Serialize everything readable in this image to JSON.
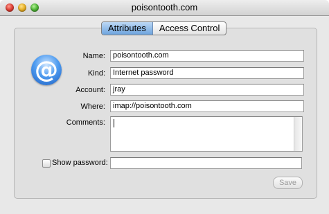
{
  "window": {
    "title": "poisontooth.com"
  },
  "tabs": [
    {
      "label": "Attributes",
      "active": true
    },
    {
      "label": "Access Control",
      "active": false
    }
  ],
  "icon": {
    "name": "at-sign-icon",
    "glyph": "@"
  },
  "fields": {
    "name": {
      "label": "Name:",
      "value": "poisontooth.com"
    },
    "kind": {
      "label": "Kind:",
      "value": "Internet password"
    },
    "account": {
      "label": "Account:",
      "value": "jray"
    },
    "where": {
      "label": "Where:",
      "value": "imap://poisontooth.com"
    },
    "comments": {
      "label": "Comments:",
      "value": ""
    }
  },
  "show_password": {
    "label": "Show password:",
    "checked": false,
    "value": ""
  },
  "save_button": {
    "label": "Save",
    "enabled": false
  },
  "colors": {
    "tab_active": "#6ea4de",
    "at_icon": "#2f7fe0"
  }
}
